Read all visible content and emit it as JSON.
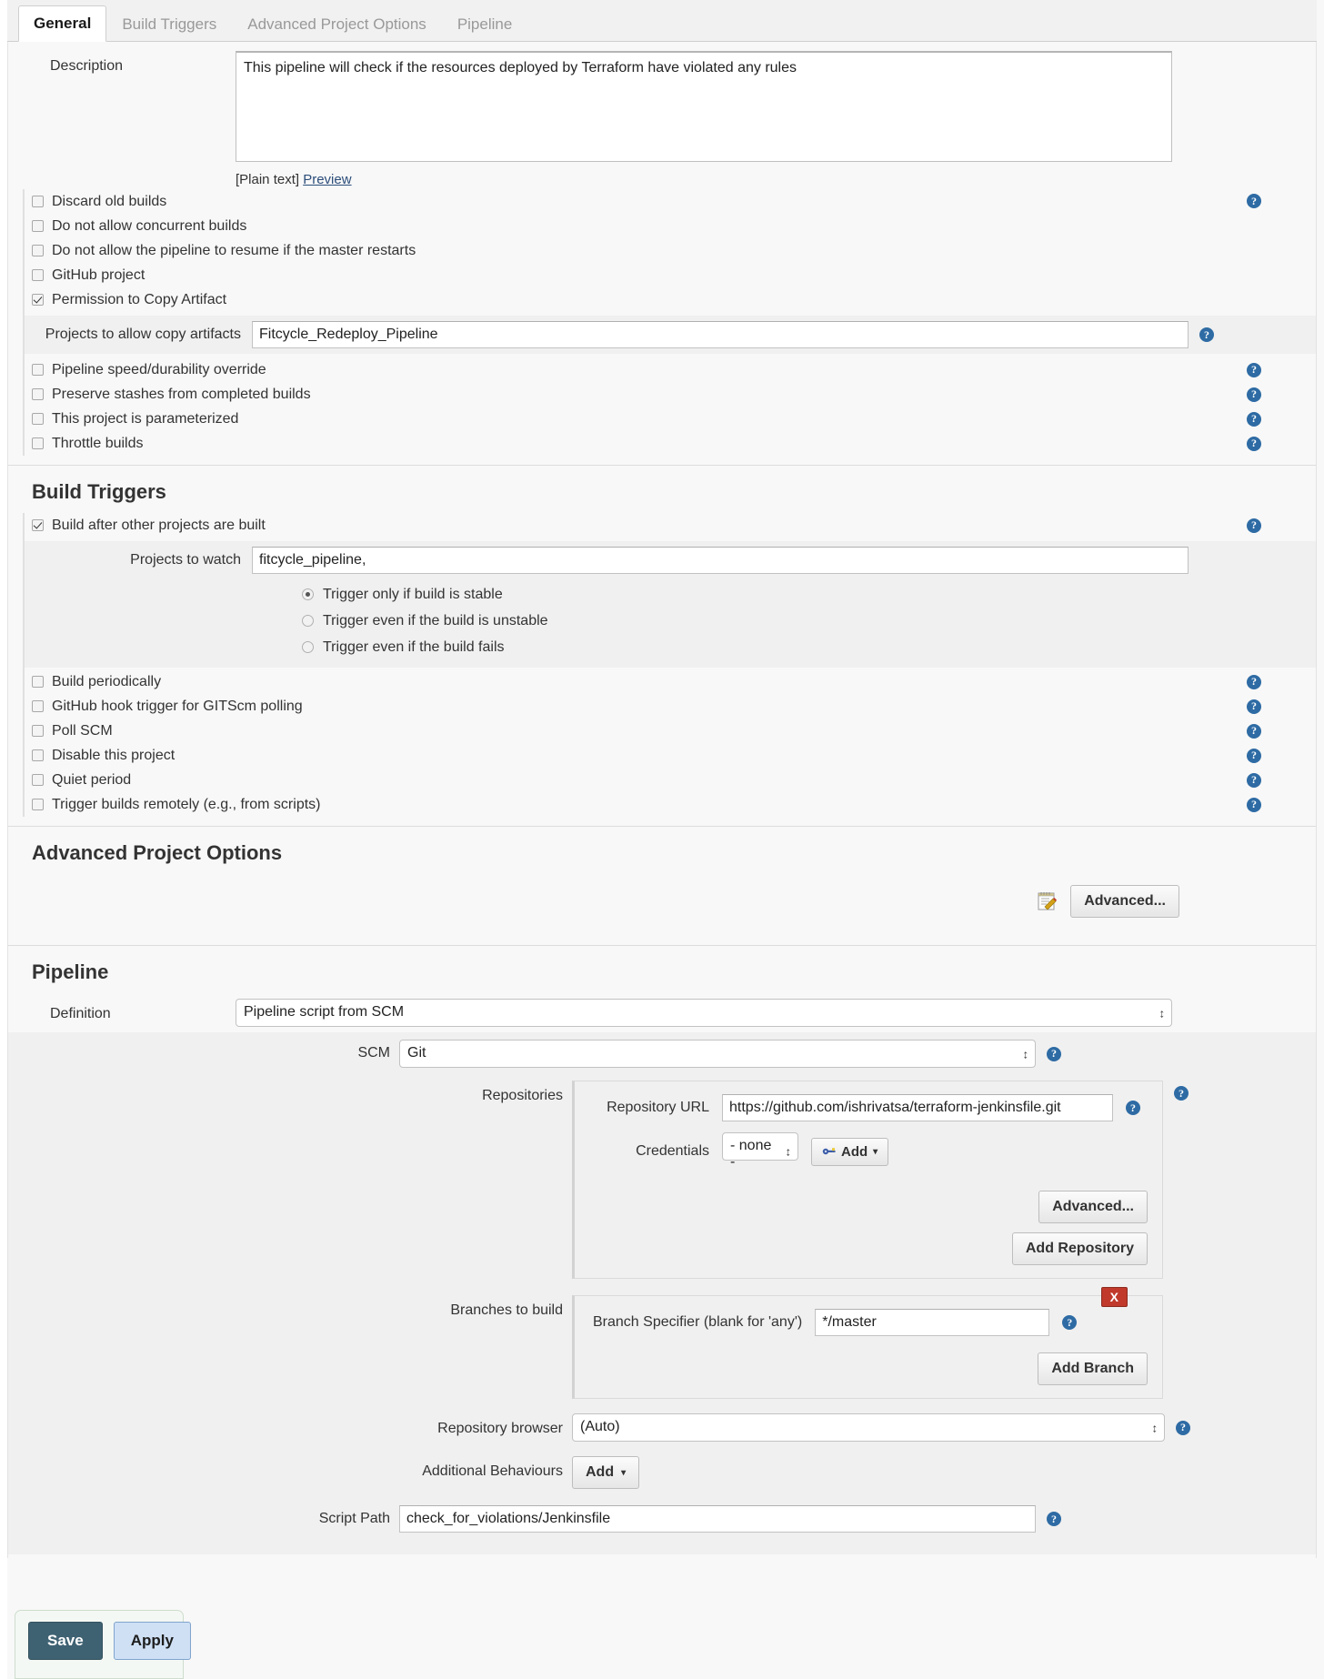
{
  "tabs": [
    {
      "label": "General",
      "active": true
    },
    {
      "label": "Build Triggers",
      "active": false
    },
    {
      "label": "Advanced Project Options",
      "active": false
    },
    {
      "label": "Pipeline",
      "active": false
    }
  ],
  "general": {
    "description_label": "Description",
    "description_value": "This pipeline will check if the resources deployed by Terraform have violated any rules",
    "plain_text_note": "[Plain text]",
    "preview_link": "Preview",
    "options": [
      {
        "label": "Discard old builds",
        "checked": false,
        "help": true
      },
      {
        "label": "Do not allow concurrent builds",
        "checked": false,
        "help": false
      },
      {
        "label": "Do not allow the pipeline to resume if the master restarts",
        "checked": false,
        "help": false
      },
      {
        "label": "GitHub project",
        "checked": false,
        "help": false
      },
      {
        "label": "Permission to Copy Artifact",
        "checked": true,
        "help": false
      }
    ],
    "copy_artifact": {
      "label": "Projects to allow copy artifacts",
      "value": "Fitcycle_Redeploy_Pipeline"
    },
    "options_after": [
      {
        "label": "Pipeline speed/durability override",
        "checked": false,
        "help": true
      },
      {
        "label": "Preserve stashes from completed builds",
        "checked": false,
        "help": true
      },
      {
        "label": "This project is parameterized",
        "checked": false,
        "help": true
      },
      {
        "label": "Throttle builds",
        "checked": false,
        "help": true
      }
    ]
  },
  "build_triggers": {
    "title": "Build Triggers",
    "build_after_label": "Build after other projects are built",
    "build_after_checked": true,
    "projects_to_watch_label": "Projects to watch",
    "projects_to_watch_value": "fitcycle_pipeline,",
    "trigger_radios": [
      {
        "label": "Trigger only if build is stable",
        "selected": true
      },
      {
        "label": "Trigger even if the build is unstable",
        "selected": false
      },
      {
        "label": "Trigger even if the build fails",
        "selected": false
      }
    ],
    "options": [
      {
        "label": "Build periodically",
        "checked": false
      },
      {
        "label": "GitHub hook trigger for GITScm polling",
        "checked": false
      },
      {
        "label": "Poll SCM",
        "checked": false
      },
      {
        "label": "Disable this project",
        "checked": false
      },
      {
        "label": "Quiet period",
        "checked": false
      },
      {
        "label": "Trigger builds remotely (e.g., from scripts)",
        "checked": false
      }
    ]
  },
  "advanced_project_options": {
    "title": "Advanced Project Options",
    "advanced_button": "Advanced..."
  },
  "pipeline": {
    "title": "Pipeline",
    "definition_label": "Definition",
    "definition_value": "Pipeline script from SCM",
    "scm_label": "SCM",
    "scm_value": "Git",
    "repositories_label": "Repositories",
    "repository_url_label": "Repository URL",
    "repository_url_value": "https://github.com/ishrivatsa/terraform-jenkinsfile.git",
    "credentials_label": "Credentials",
    "credentials_value": "- none -",
    "credentials_add_button": "Add",
    "repo_advanced_button": "Advanced...",
    "add_repository_button": "Add Repository",
    "branches_label": "Branches to build",
    "branch_specifier_label": "Branch Specifier (blank for 'any')",
    "branch_specifier_value": "*/master",
    "branch_delete_button": "X",
    "add_branch_button": "Add Branch",
    "repository_browser_label": "Repository browser",
    "repository_browser_value": "(Auto)",
    "additional_behaviours_label": "Additional Behaviours",
    "additional_behaviours_button": "Add",
    "script_path_label": "Script Path",
    "script_path_value": "check_for_violations/Jenkinsfile"
  },
  "footer": {
    "save_label": "Save",
    "apply_label": "Apply"
  },
  "icons": {
    "help": "?",
    "chevron_down": "▾"
  }
}
